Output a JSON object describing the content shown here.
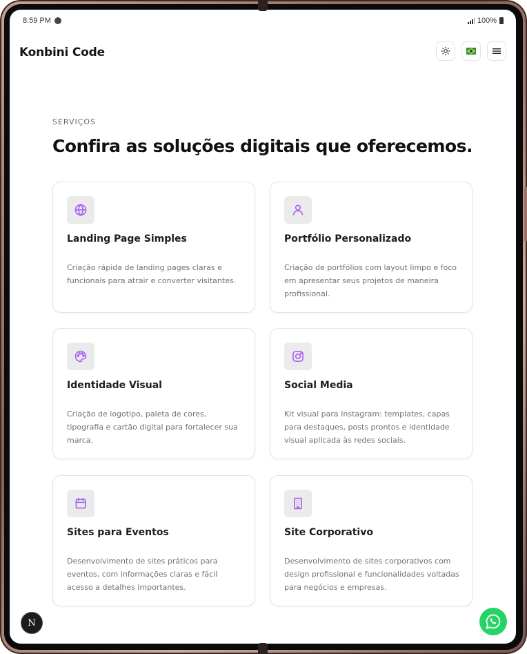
{
  "status_bar": {
    "time": "8:59 PM",
    "battery": "100%"
  },
  "header": {
    "brand": "Konbini Code",
    "buttons": [
      {
        "name": "theme-toggle",
        "icon": "sun-icon"
      },
      {
        "name": "language",
        "icon": "brazil-flag-icon"
      },
      {
        "name": "menu",
        "icon": "hamburger-icon"
      }
    ]
  },
  "services": {
    "eyebrow": "SERVIÇOS",
    "heading": "Confira as soluções digitais que oferecemos.",
    "items": [
      {
        "icon": "globe-icon",
        "title": "Landing Page Simples",
        "description": "Criação rápida de landing pages claras e funcionais para atrair e converter visitantes."
      },
      {
        "icon": "user-icon",
        "title": "Portfólio Personalizado",
        "description": "Criação de portfólios com layout limpo e foco em apresentar seus projetos de maneira profissional."
      },
      {
        "icon": "palette-icon",
        "title": "Identidade Visual",
        "description": "Criação de logotipo, paleta de cores, tipografia e cartão digital para fortalecer sua marca."
      },
      {
        "icon": "instagram-icon",
        "title": "Social Media",
        "description": "Kit visual para Instagram: templates, capas para destaques, posts prontos e identidade visual aplicada às redes sociais."
      },
      {
        "icon": "calendar-icon",
        "title": "Sites para Eventos",
        "description": "Desenvolvimento de sites práticos para eventos, com informações claras e fácil acesso a detalhes importantes."
      },
      {
        "icon": "building-icon",
        "title": "Site Corporativo",
        "description": "Desenvolvimento de sites corporativos com design profissional e funcionalidades voltadas para negócios e empresas."
      }
    ]
  },
  "floating": {
    "next_badge": "N"
  },
  "colors": {
    "accent": "#a855f7",
    "whatsapp": "#25d366",
    "icon_bg": "#ebebeb"
  }
}
